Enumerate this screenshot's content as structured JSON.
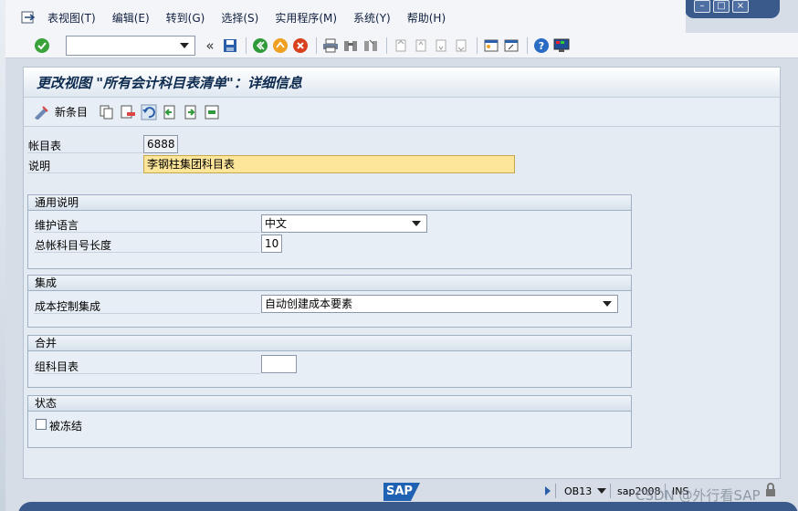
{
  "menubar": {
    "items": [
      "表视图(T)",
      "编辑(E)",
      "转到(G)",
      "选择(S)",
      "实用程序(M)",
      "系统(Y)",
      "帮助(H)"
    ]
  },
  "toolbar": {
    "command_value": ""
  },
  "screen": {
    "title": "更改视图 \"所有会计科目表清单\"：详细信息",
    "new_entries_label": "新条目"
  },
  "header": {
    "coa_label": "帐目表",
    "coa_value": "6888",
    "description_label": "说明",
    "description_value": "李钢柱集团科目表"
  },
  "general": {
    "title": "通用说明",
    "lang_label": "维护语言",
    "lang_value": "中文",
    "length_label": "总帐科目号长度",
    "length_value": "10"
  },
  "integration": {
    "title": "集成",
    "co_label": "成本控制集成",
    "co_value": "自动创建成本要素"
  },
  "consolidation": {
    "title": "合并",
    "group_coa_label": "组科目表",
    "group_coa_value": ""
  },
  "status": {
    "title": "状态",
    "blocked_label": "被冻结",
    "blocked_checked": false
  },
  "statusbar": {
    "logo": "SAP",
    "transaction": "OB13",
    "system": "sap2008",
    "mode": "INS"
  },
  "watermark": "CSDN @外行看SAP",
  "colors": {
    "accent": "#1f62b3",
    "highlight_field": "#fde59a",
    "title_text": "#0d2a4f"
  }
}
